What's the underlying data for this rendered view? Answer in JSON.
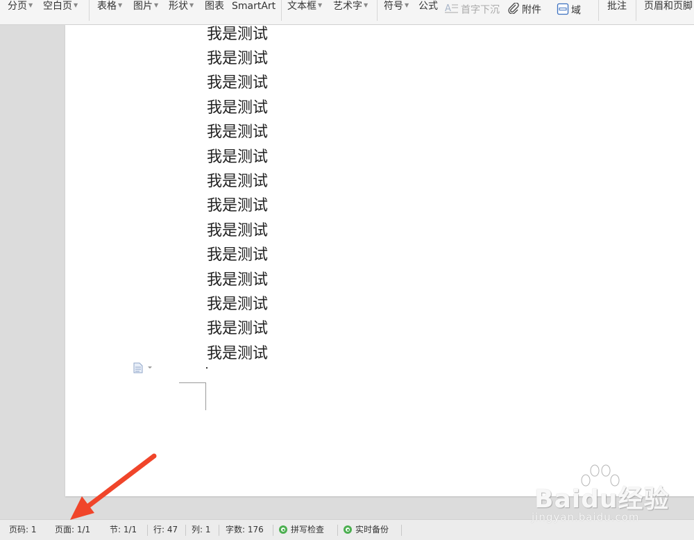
{
  "toolbar": {
    "items": [
      {
        "label": "分页",
        "dropdown": true
      },
      {
        "label": "空白页",
        "dropdown": true
      },
      {
        "label": "表格",
        "dropdown": true
      },
      {
        "label": "图片",
        "dropdown": true
      },
      {
        "label": "形状",
        "dropdown": true
      },
      {
        "label": "图表",
        "dropdown": false
      },
      {
        "label": "SmartArt",
        "dropdown": false
      },
      {
        "label": "文本框",
        "dropdown": true
      },
      {
        "label": "艺术字",
        "dropdown": true
      },
      {
        "label": "符号",
        "dropdown": true
      },
      {
        "label": "公式",
        "dropdown": false
      },
      {
        "label": "首字下沉",
        "dropdown": false,
        "icon": "drop-cap-icon",
        "disabled": true
      },
      {
        "label": "附件",
        "dropdown": false,
        "icon": "paperclip-icon"
      },
      {
        "label": "域",
        "dropdown": false,
        "icon": "field-icon"
      },
      {
        "label": "批注",
        "dropdown": false
      },
      {
        "label": "页眉和页脚",
        "dropdown": false
      }
    ]
  },
  "document": {
    "lines": [
      "我是测试",
      "我是测试",
      "我是测试",
      "我是测试",
      "我是测试",
      "我是测试",
      "我是测试",
      "我是测试",
      "我是测试",
      "我是测试",
      "我是测试",
      "我是测试",
      "我是测试",
      "我是测试"
    ]
  },
  "statusbar": {
    "page_code": "页码: 1",
    "pages": "页面: 1/1",
    "section": "节: 1/1",
    "row": "行: 47",
    "column": "列: 1",
    "word_count": "字数: 176",
    "spell_check": "拼写检查",
    "realtime_backup": "实时备份"
  },
  "watermark": {
    "logo": "Baidu经验",
    "url": "jingyan.baidu.com"
  },
  "colors": {
    "arrow": "#f0452a",
    "status_ok": "#4caf50",
    "page_bg": "#ffffff",
    "workspace_bg": "#dcdcdc"
  }
}
